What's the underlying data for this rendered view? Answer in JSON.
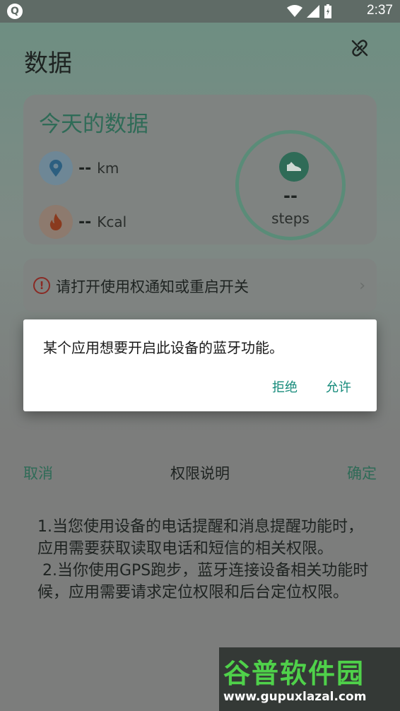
{
  "status_bar": {
    "time": "2:37"
  },
  "page": {
    "title": "数据",
    "today_card": {
      "title": "今天的数据",
      "distance": {
        "value": "--",
        "unit": "km"
      },
      "calories": {
        "value": "--",
        "unit": "Kcal"
      },
      "steps": {
        "value": "--",
        "unit": "steps"
      }
    },
    "notice": {
      "text": "请打开使用权通知或重启开关"
    },
    "permission_sheet": {
      "cancel": "取消",
      "title": "权限说明",
      "confirm": "确定",
      "body": "1.当您使用设备的电话提醒和消息提醒功能时，应用需要获取读取电话和短信的相关权限。\n 2.当你使用GPS跑步，蓝牙连接设备相关功能时候，应用需要请求定位权限和后台定位权限。"
    }
  },
  "dialog": {
    "message": "某个应用想要开启此设备的蓝牙功能。",
    "deny": "拒绝",
    "allow": "允许"
  },
  "watermark": {
    "main": "谷普软件园",
    "url": "www.gupuxlazal.com"
  },
  "colors": {
    "accent_green": "#2f6b57",
    "dialog_button": "#148a7a",
    "warning_red": "#8a2a24"
  }
}
